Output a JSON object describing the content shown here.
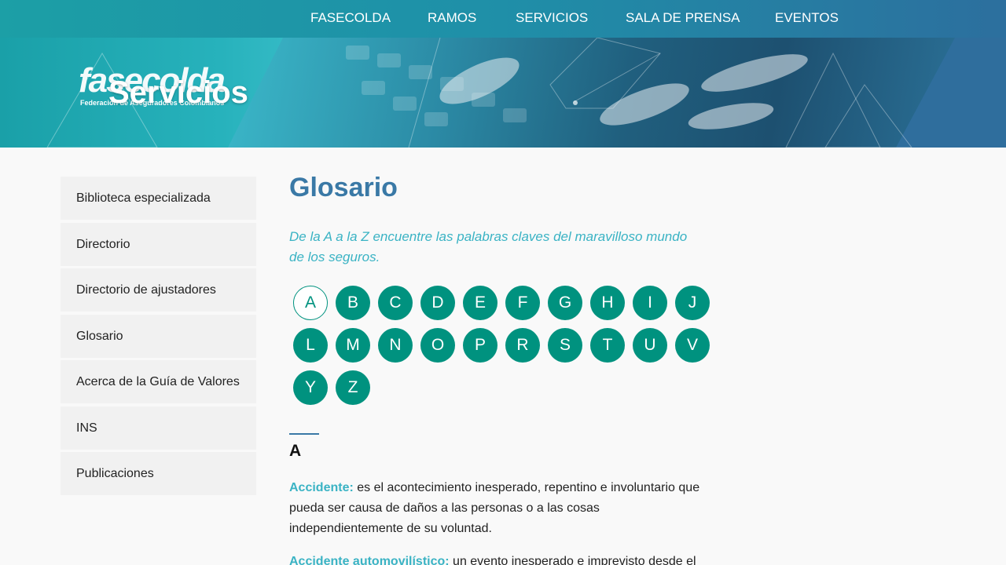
{
  "nav": {
    "items": [
      "FASECOLDA",
      "RAMOS",
      "SERVICIOS",
      "SALA DE PRENSA",
      "EVENTOS"
    ]
  },
  "hero": {
    "logo": "fasecolda",
    "logo_sub": "Federación de Aseguradores Colombianos",
    "section_title": "Servicios"
  },
  "sidebar": {
    "items": [
      "Biblioteca especializada",
      "Directorio",
      "Directorio de ajustadores",
      "Glosario",
      "Acerca de la Guía de Valores",
      "INS",
      "Publicaciones"
    ]
  },
  "main": {
    "title": "Glosario",
    "subtitle": "De la A a la Z encuentre las palabras claves del maravilloso mundo de los seguros.",
    "letters": [
      "A",
      "B",
      "C",
      "D",
      "E",
      "F",
      "G",
      "H",
      "I",
      "J",
      "L",
      "M",
      "N",
      "O",
      "P",
      "R",
      "S",
      "T",
      "U",
      "V",
      "Y",
      "Z"
    ],
    "active_letter": "A",
    "section_letter": "A",
    "entries": [
      {
        "term": "Accidente:",
        "definition": " es el acontecimiento inesperado, repentino e involuntario que pueda ser causa de daños a las personas o a las cosas independientemente de su voluntad."
      },
      {
        "term": "Accidente automovilístico:",
        "definition": " un evento inesperado e imprevisto desde el"
      }
    ]
  },
  "colors": {
    "nav_bg": "#1f8fa8",
    "title": "#3a79a6",
    "accent": "#3ab3c4",
    "letter_bg": "#00927f",
    "sidebar_bg": "#f1f1f1"
  }
}
